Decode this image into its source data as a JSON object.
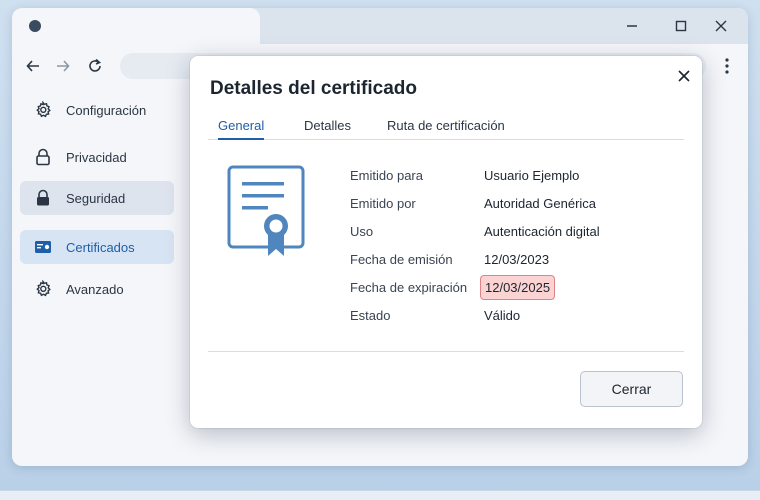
{
  "sidebar": {
    "items": [
      {
        "label": "Configuración",
        "icon": "gear-icon"
      },
      {
        "label": "Privacidad",
        "icon": "padlock-icon"
      },
      {
        "label": "Seguridad",
        "icon": "padlock-icon"
      },
      {
        "label": "Certificados",
        "icon": "certificate-card-icon"
      },
      {
        "label": "Avanzado",
        "icon": "gear-icon"
      }
    ],
    "selected": "Certificados"
  },
  "dialog": {
    "title": "Detalles del certificado",
    "tabs": [
      "General",
      "Detalles",
      "Ruta de certificación"
    ],
    "active_tab": "General",
    "fields": [
      {
        "label": "Emitido para",
        "value": "Usuario Ejemplo"
      },
      {
        "label": "Emitido por",
        "value": "Autoridad Genérica"
      },
      {
        "label": "Uso",
        "value": "Autenticación digital"
      },
      {
        "label": "Fecha de emisión",
        "value": "12/03/2023"
      },
      {
        "label": "Fecha de expiración",
        "value": "12/03/2025"
      },
      {
        "label": "Estado",
        "value": "Válido"
      }
    ],
    "close_button": "Cerrar"
  },
  "colors": {
    "accent": "#1f5fa8",
    "expired_highlight": "#fbd3d3",
    "expired_border": "#e08585"
  }
}
